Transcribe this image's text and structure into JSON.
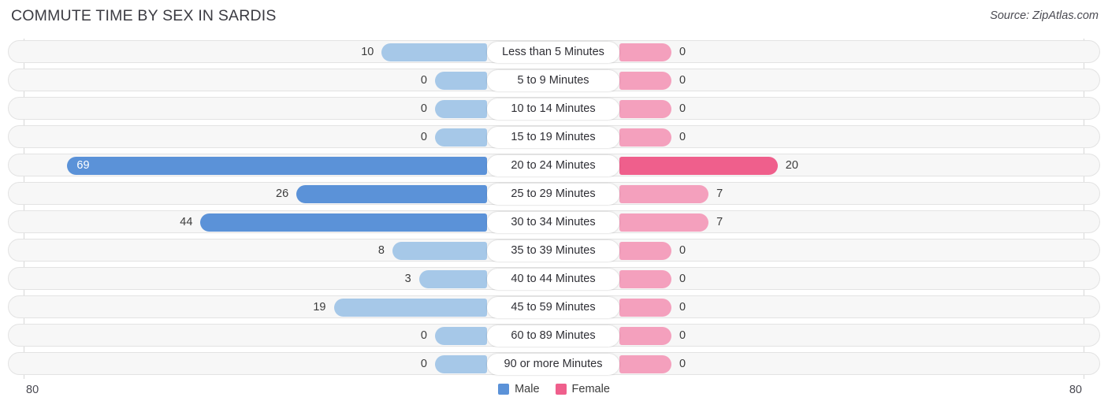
{
  "header": {
    "title": "COMMUTE TIME BY SEX IN SARDIS",
    "source": "Source: ZipAtlas.com"
  },
  "legend": {
    "male_label": "Male",
    "female_label": "Female",
    "male_color": "#5b92d8",
    "female_color": "#ef5f8c"
  },
  "axis": {
    "left_label": "80",
    "right_label": "80",
    "max": 80
  },
  "colors": {
    "bar_male_strong": "#5b92d8",
    "bar_male_light": "#a6c8e8",
    "bar_female_strong": "#ef5f8c",
    "bar_female_light": "#f4a0bd",
    "row_bg": "#f7f7f7",
    "row_border": "#e3e3e3",
    "gridline": "#d7d7d7",
    "text": "#3c3c3c"
  },
  "chart_data": {
    "type": "bar",
    "title": "COMMUTE TIME BY SEX IN SARDIS",
    "subtitle": "Source: ZipAtlas.com",
    "orientation": "horizontal-diverging",
    "xlabel": "",
    "ylabel": "",
    "xlim": [
      80,
      80
    ],
    "grid": true,
    "legend_position": "bottom-center",
    "categories": [
      "Less than 5 Minutes",
      "5 to 9 Minutes",
      "10 to 14 Minutes",
      "15 to 19 Minutes",
      "20 to 24 Minutes",
      "25 to 29 Minutes",
      "30 to 34 Minutes",
      "35 to 39 Minutes",
      "40 to 44 Minutes",
      "45 to 59 Minutes",
      "60 to 89 Minutes",
      "90 or more Minutes"
    ],
    "series": [
      {
        "name": "Male",
        "side": "left",
        "color": "#5b92d8",
        "values": [
          10,
          0,
          0,
          0,
          69,
          26,
          44,
          8,
          3,
          19,
          0,
          0
        ]
      },
      {
        "name": "Female",
        "side": "right",
        "color": "#ef5f8c",
        "values": [
          0,
          0,
          0,
          0,
          20,
          7,
          7,
          0,
          0,
          0,
          0,
          0
        ]
      }
    ]
  }
}
